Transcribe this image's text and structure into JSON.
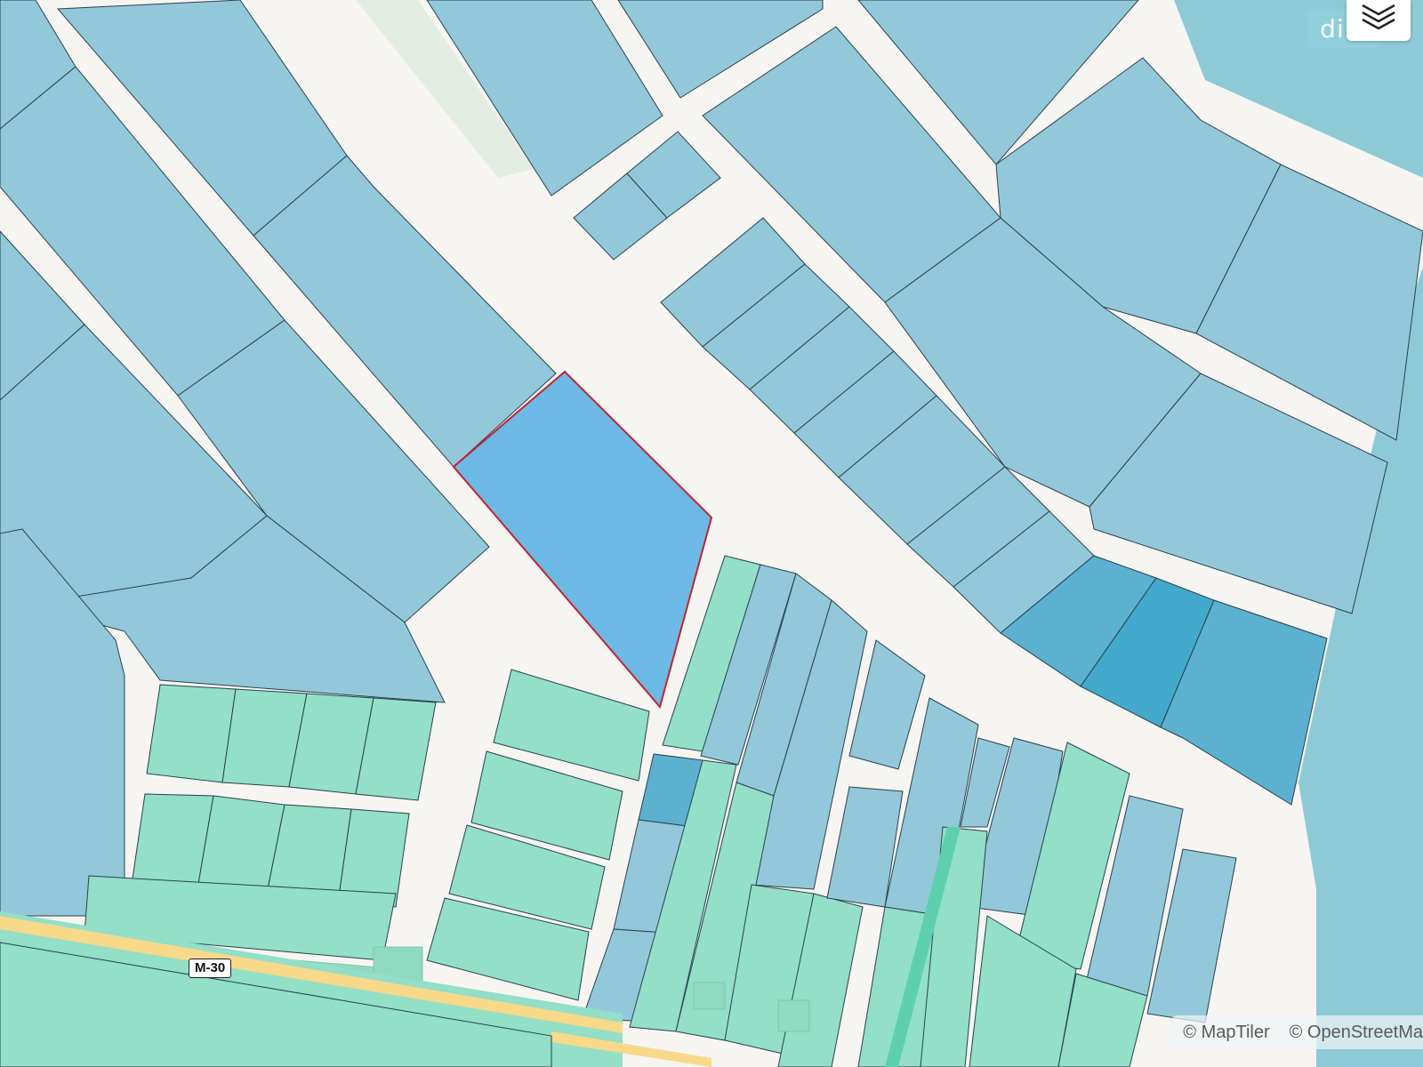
{
  "map": {
    "brand_text": "dim",
    "road_label": "M-30",
    "attribution": [
      "© MapTiler",
      "© OpenStreetMa"
    ],
    "colors": {
      "background": "#f7f5f2",
      "parcel_blue": "#93c8da",
      "parcel_green": "#93dfc7",
      "parcel_mid": "#5cb1d0",
      "parcel_dark": "#42a9cc",
      "selected_fill": "#6cb9e6",
      "selected_outline": "#c0242d",
      "road_major": "#f7d989"
    }
  },
  "controls": {
    "layers_icon": "layers-icon"
  }
}
